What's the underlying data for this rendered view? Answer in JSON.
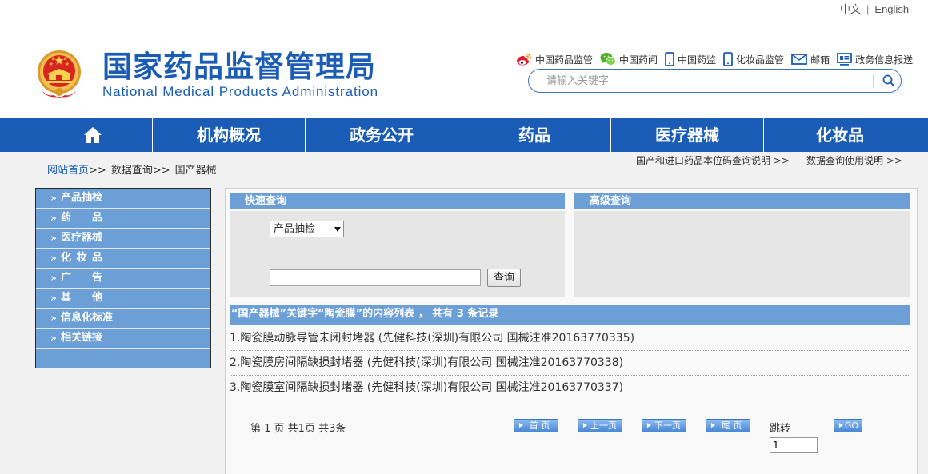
{
  "colors": {
    "brand_blue": "#1b5cb6",
    "panel_blue": "#6b9fd5",
    "panel_gray": "#e6e6e6",
    "page_bg": "#f1f1f1"
  },
  "language_switch": {
    "chinese": "中文",
    "separator": "|",
    "english": "English"
  },
  "header": {
    "logo_icon": "national-emblem-icon",
    "title": "国家药品监督管理局",
    "subtitle": "National Medical Products Administration",
    "links": [
      {
        "label": "中国药品监管",
        "icon": "weibo-icon"
      },
      {
        "label": "中国药闻",
        "icon": "wechat-icon"
      },
      {
        "label": "中国药监",
        "icon": "mobile-phone-icon"
      },
      {
        "label": "化妆品监管",
        "icon": "mobile-phone-icon"
      },
      {
        "label": "邮箱",
        "icon": "mail-icon"
      },
      {
        "label": "政务信息报送",
        "icon": "monitor-icon"
      }
    ],
    "search": {
      "placeholder": "请输入关键字",
      "icon": "search-icon"
    }
  },
  "nav": {
    "home_icon": "home-icon",
    "items": [
      "机构概况",
      "政务公开",
      "药品",
      "医疗器械",
      "化妆品"
    ]
  },
  "breadcrumb": {
    "items": [
      "网站首页",
      "数据查询",
      "国产器械"
    ],
    "separator": ">>"
  },
  "help_links": [
    "国产和进口药品本位码查询说明 >>",
    "数据查询使用说明 >>"
  ],
  "sidebar": {
    "icon": "double-chevron-icon",
    "items": [
      "产品抽检",
      "药 品",
      "医疗器械",
      "化 妆 品",
      "广 告",
      "其 他",
      "信息化标准",
      "相关链接"
    ]
  },
  "quick_search": {
    "title": "快速查询",
    "category": {
      "selected": "产品抽检",
      "icon": "dropdown-arrow-icon"
    },
    "submit_label": "查询"
  },
  "advanced_search": {
    "title": "高级查询"
  },
  "results": {
    "summary": "“国产器械”关键字“陶瓷膜”的内容列表 ， 共有 3 条记录",
    "items": [
      "1.陶瓷膜动脉导管未闭封堵器 (先健科技(深圳)有限公司 国械注准20163770335)",
      "2.陶瓷膜房间隔缺损封堵器 (先健科技(深圳)有限公司 国械注准20163770338)",
      "3.陶瓷膜室间隔缺损封堵器 (先健科技(深圳)有限公司 国械注准20163770337)"
    ]
  },
  "pagination": {
    "info": "第 1 页 共1页 共3条",
    "first_label": "首 页",
    "prev_label": "上一页",
    "next_label": "下一页",
    "last_label": "尾 页",
    "button_icon": "arrow-right-icon",
    "jump_label": "跳转",
    "jump_value": "1",
    "go_label": "GO"
  }
}
